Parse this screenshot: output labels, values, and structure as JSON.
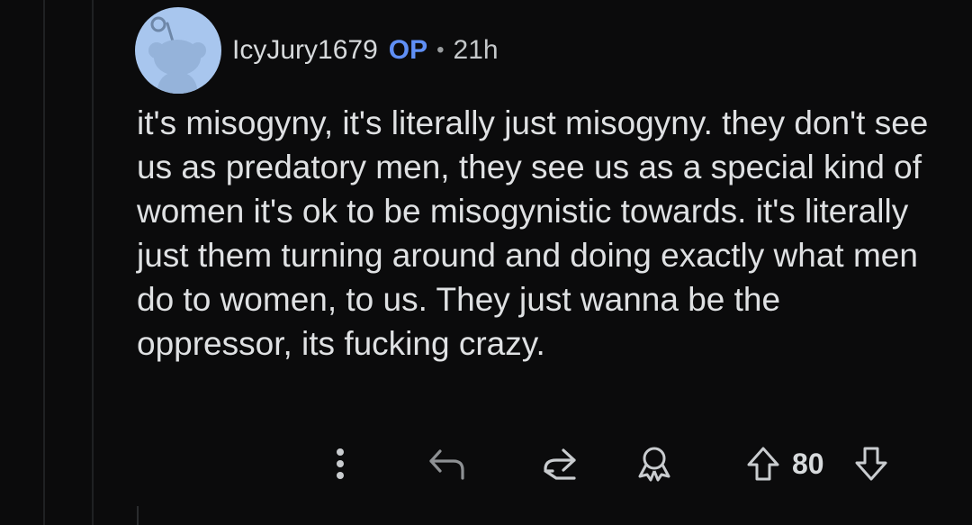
{
  "comment": {
    "username": "IcyJury1679",
    "op_badge": "OP",
    "separator": "•",
    "age": "21h",
    "avatar_icon": "snoo-avatar-icon",
    "body": "it's misogyny, it's literally just misogyny. they don't see us as predatory men, they see us as a special kind of women it's ok to be misogynistic towards. it's literally just them turning around and doing exactly what men do to women, to us. They just wanna be the oppressor, its fucking crazy."
  },
  "actions": {
    "more_icon": "more-vertical-icon",
    "reply_icon": "reply-arrow-icon",
    "share_icon": "share-icon",
    "award_icon": "award-icon",
    "upvote_icon": "upvote-arrow-icon",
    "score": "80",
    "downvote_icon": "downvote-arrow-icon"
  },
  "colors": {
    "background": "#0b0b0c",
    "text": "#d7dadc",
    "op_badge": "#5f8ff5",
    "avatar_bg": "#a8c6ee"
  }
}
